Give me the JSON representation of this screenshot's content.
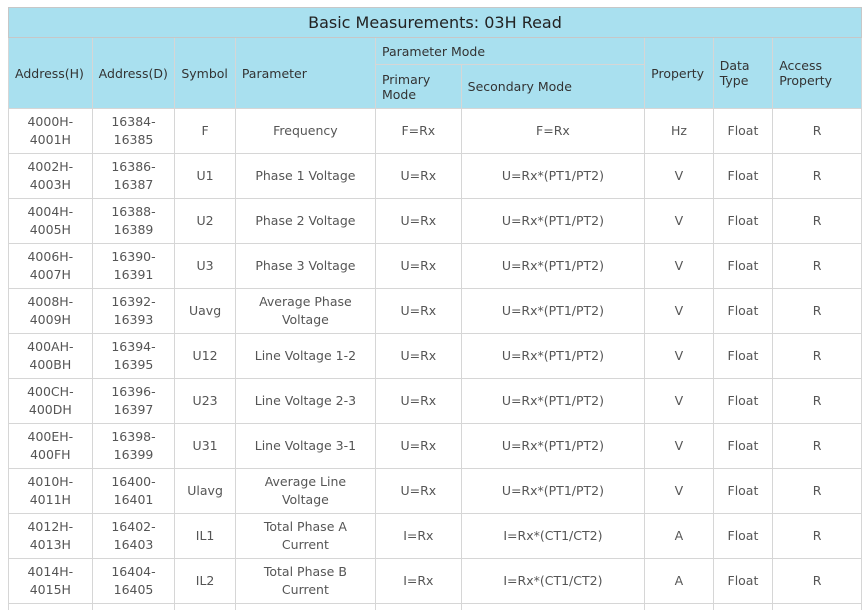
{
  "title": "Basic Measurements: 03H Read",
  "headers": {
    "address_h": "Address(H)",
    "address_d": "Address(D)",
    "symbol": "Symbol",
    "parameter": "Parameter",
    "parameter_mode": "Parameter Mode",
    "primary_mode": "Primary Mode",
    "secondary_mode": "Secondary Mode",
    "property": "Property",
    "data_type": "Data Type",
    "access_property": "Access Property"
  },
  "rows": [
    {
      "addr_h": "4000H-\n4001H",
      "addr_d": "16384-\n16385",
      "symbol": "F",
      "parameter": "Frequency",
      "primary": "F=Rx",
      "secondary": "F=Rx",
      "property": "Hz",
      "type": "Float",
      "access": "R"
    },
    {
      "addr_h": "4002H-\n4003H",
      "addr_d": "16386-\n16387",
      "symbol": "U1",
      "parameter": "Phase 1 Voltage",
      "primary": "U=Rx",
      "secondary": "U=Rx*(PT1/PT2)",
      "property": "V",
      "type": "Float",
      "access": "R"
    },
    {
      "addr_h": "4004H-\n4005H",
      "addr_d": "16388-\n16389",
      "symbol": "U2",
      "parameter": "Phase 2 Voltage",
      "primary": "U=Rx",
      "secondary": "U=Rx*(PT1/PT2)",
      "property": "V",
      "type": "Float",
      "access": "R"
    },
    {
      "addr_h": "4006H-\n4007H",
      "addr_d": "16390-\n16391",
      "symbol": "U3",
      "parameter": "Phase 3 Voltage",
      "primary": "U=Rx",
      "secondary": "U=Rx*(PT1/PT2)",
      "property": "V",
      "type": "Float",
      "access": "R"
    },
    {
      "addr_h": "4008H-\n4009H",
      "addr_d": "16392-\n16393",
      "symbol": "Uavg",
      "parameter": "Average Phase\nVoltage",
      "primary": "U=Rx",
      "secondary": "U=Rx*(PT1/PT2)",
      "property": "V",
      "type": "Float",
      "access": "R"
    },
    {
      "addr_h": "400AH-\n400BH",
      "addr_d": "16394-\n16395",
      "symbol": "U12",
      "parameter": "Line Voltage 1-2",
      "primary": "U=Rx",
      "secondary": "U=Rx*(PT1/PT2)",
      "property": "V",
      "type": "Float",
      "access": "R"
    },
    {
      "addr_h": "400CH-\n400DH",
      "addr_d": "16396-\n16397",
      "symbol": "U23",
      "parameter": "Line Voltage 2-3",
      "primary": "U=Rx",
      "secondary": "U=Rx*(PT1/PT2)",
      "property": "V",
      "type": "Float",
      "access": "R"
    },
    {
      "addr_h": "400EH-\n400FH",
      "addr_d": "16398-\n16399",
      "symbol": "U31",
      "parameter": "Line Voltage 3-1",
      "primary": "U=Rx",
      "secondary": "U=Rx*(PT1/PT2)",
      "property": "V",
      "type": "Float",
      "access": "R"
    },
    {
      "addr_h": "4010H-\n4011H",
      "addr_d": "16400-\n16401",
      "symbol": "Ulavg",
      "parameter": "Average Line\nVoltage",
      "primary": "U=Rx",
      "secondary": "U=Rx*(PT1/PT2)",
      "property": "V",
      "type": "Float",
      "access": "R"
    },
    {
      "addr_h": "4012H-\n4013H",
      "addr_d": "16402-\n16403",
      "symbol": "IL1",
      "parameter": "Total Phase A\nCurrent",
      "primary": "I=Rx",
      "secondary": "I=Rx*(CT1/CT2)",
      "property": "A",
      "type": "Float",
      "access": "R"
    },
    {
      "addr_h": "4014H-\n4015H",
      "addr_d": "16404-\n16405",
      "symbol": "IL2",
      "parameter": "Total Phase B\nCurrent",
      "primary": "I=Rx",
      "secondary": "I=Rx*(CT1/CT2)",
      "property": "A",
      "type": "Float",
      "access": "R"
    }
  ]
}
